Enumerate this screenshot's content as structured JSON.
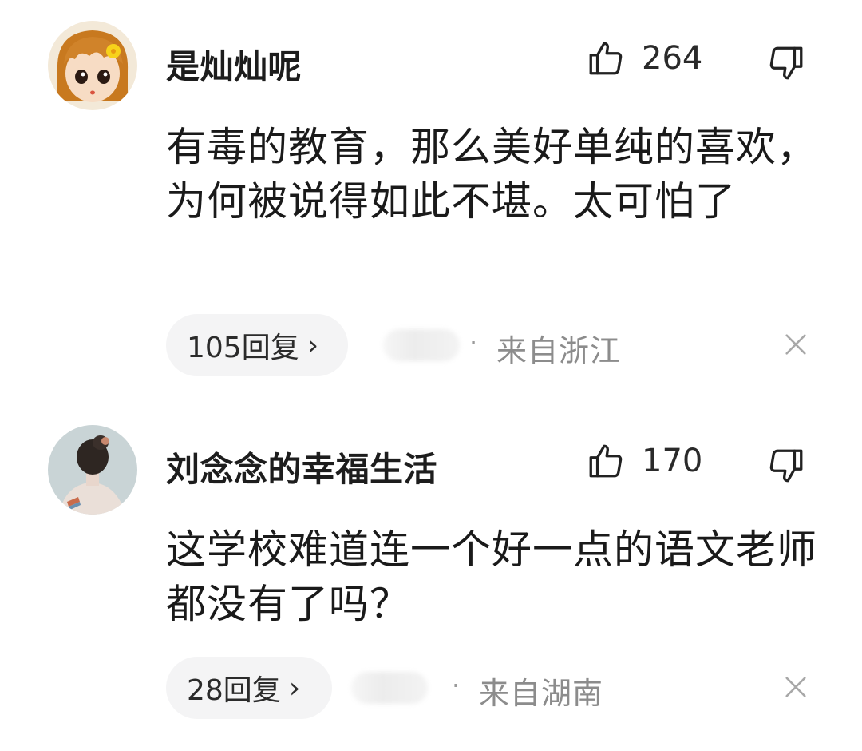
{
  "comments": [
    {
      "username": "是灿灿呢",
      "like_count": "264",
      "text": "有毒的教育，那么美好单纯的喜欢，为何被说得如此不堪。太可怕了",
      "reply_label": "105回复",
      "separator": "·",
      "location": "来自浙江",
      "avatar_icon": "cartoon-girl-avatar"
    },
    {
      "username": "刘念念的幸福生活",
      "like_count": "170",
      "text": "这学校难道连一个好一点的语文老师都没有了吗？",
      "reply_label": "28回复",
      "separator": "·",
      "location": "来自湖南",
      "avatar_icon": "woman-back-photo-avatar"
    }
  ],
  "icons": {
    "like": "thumbs-up-icon",
    "dislike": "thumbs-down-icon",
    "close": "close-icon",
    "chevron": "chevron-right-icon"
  },
  "chevron_glyph": "›"
}
